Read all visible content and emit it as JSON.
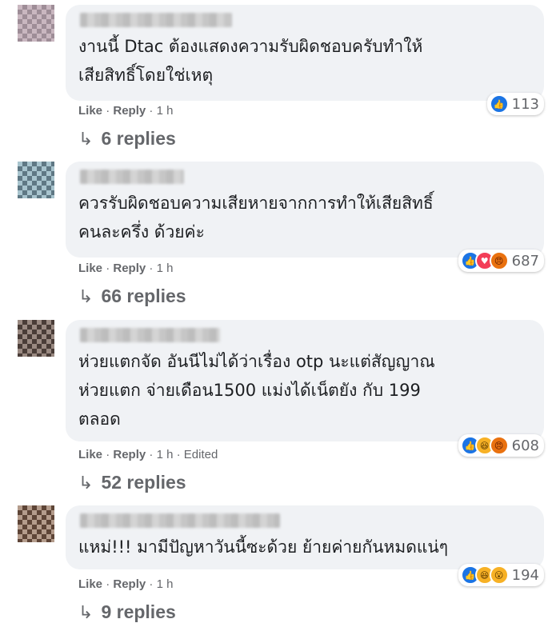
{
  "comments": [
    {
      "text": "งานนี้ Dtac ต้องแสดงความรับผิดชอบครับทำให้\nเสียสิทธิ์โดยใช่เหตุ",
      "reactions": [
        "like"
      ],
      "reaction_count": "113",
      "like_label": "Like",
      "reply_label": "Reply",
      "time": "1 h",
      "edited": "",
      "replies": "6 replies"
    },
    {
      "text": "ควรรับผิดชอบความเสียหายจากการทำให้เสียสิทธิ์\nคนละครึ่ง ด้วยค่ะ",
      "reactions": [
        "like",
        "love",
        "angry"
      ],
      "reaction_count": "687",
      "like_label": "Like",
      "reply_label": "Reply",
      "time": "1 h",
      "edited": "",
      "replies": "66 replies"
    },
    {
      "text": "ห่วยแตกจัด อันนีไม่ได้ว่าเรื่อง otp นะแต่สัญญาณ\nห่วยแตก จ่ายเดือน1500 แม่งได้เน็ตยัง กับ 199\nตลอด",
      "reactions": [
        "like",
        "haha",
        "angry"
      ],
      "reaction_count": "608",
      "like_label": "Like",
      "reply_label": "Reply",
      "time": "1 h",
      "edited": "Edited",
      "replies": "52 replies"
    },
    {
      "text": "แหม่!!! มามีปัญหาวันนี้ซะด้วย ย้ายค่ายกันหมดแน่ๆ",
      "reactions": [
        "like",
        "haha",
        "wow"
      ],
      "reaction_count": "194",
      "like_label": "Like",
      "reply_label": "Reply",
      "time": "1 h",
      "edited": "",
      "replies": "9 replies"
    }
  ],
  "reply_arrow": "↳",
  "separator": "·",
  "colors": {
    "bubble": "#f0f2f5",
    "meta": "#65676b",
    "like": "#1b74e4"
  }
}
